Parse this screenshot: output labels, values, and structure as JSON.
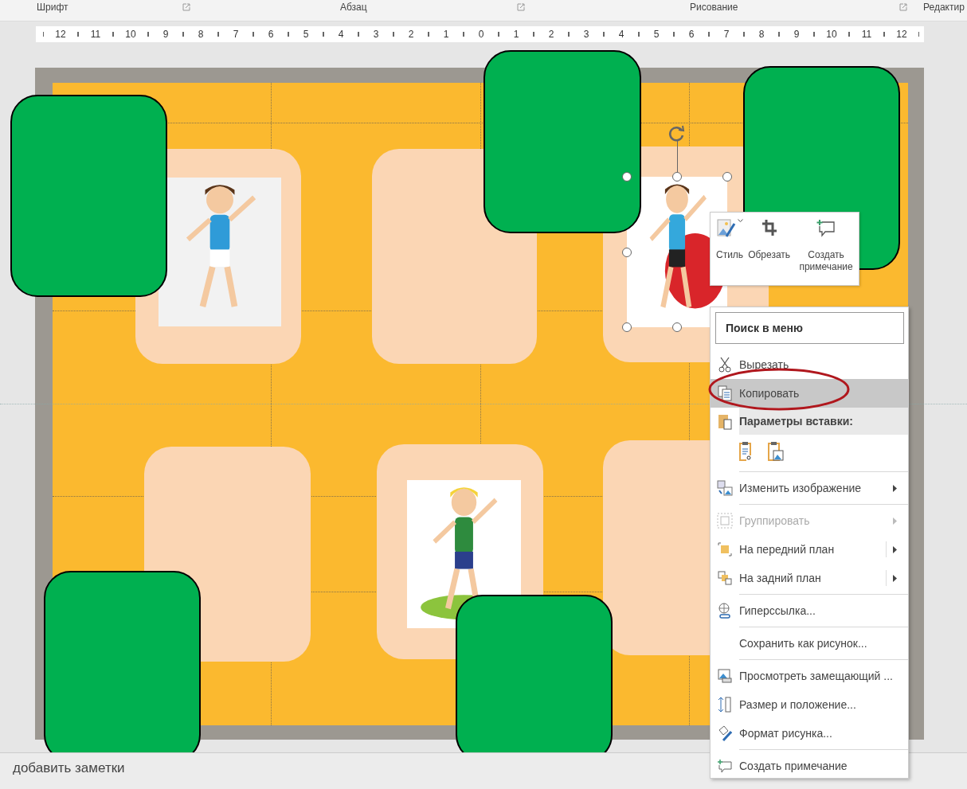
{
  "ribbon_groups": [
    {
      "label": "Шрифт",
      "launcher": true
    },
    {
      "label": "Абзац",
      "launcher": true
    },
    {
      "label": "Рисование",
      "launcher": true
    },
    {
      "label": "Редактир",
      "launcher": false
    }
  ],
  "ruler": [
    "12",
    "11",
    "10",
    "9",
    "8",
    "7",
    "6",
    "5",
    "4",
    "3",
    "2",
    "1",
    "0",
    "1",
    "2",
    "3",
    "4",
    "5",
    "6",
    "7",
    "8",
    "9",
    "10",
    "11",
    "12"
  ],
  "slide": {
    "pictures": [
      {
        "kind": "picture",
        "selected": false
      },
      {
        "kind": "picture",
        "selected": true
      },
      {
        "kind": "picture",
        "selected": false
      }
    ]
  },
  "mini_toolbar": [
    {
      "label": "Стиль",
      "dropdown": true
    },
    {
      "label": "Обрезать",
      "dropdown": false
    },
    {
      "label": "Создать примечание",
      "dropdown": false
    }
  ],
  "context_menu": {
    "search": {
      "placeholder": "Поиск в меню"
    },
    "items": [
      {
        "kind": "item",
        "label": "Вырезать",
        "selected": false,
        "disabled": false,
        "submenu": false,
        "separator_after": false
      },
      {
        "kind": "item",
        "label": "Копировать",
        "selected": true,
        "disabled": false,
        "submenu": false,
        "separator_after": false
      },
      {
        "kind": "header",
        "label": "Параметры вставки:"
      },
      {
        "kind": "paste-options",
        "separator_after": true
      },
      {
        "kind": "item",
        "label": "Изменить изображение",
        "selected": false,
        "disabled": false,
        "submenu": true,
        "separator_after": true
      },
      {
        "kind": "item",
        "label": "Группировать",
        "selected": false,
        "disabled": true,
        "submenu": true,
        "separator_after": false
      },
      {
        "kind": "item",
        "label": "На передний план",
        "selected": false,
        "disabled": false,
        "submenu": true,
        "separator_after": false
      },
      {
        "kind": "item",
        "label": "На задний план",
        "selected": false,
        "disabled": false,
        "submenu": true,
        "separator_after": true
      },
      {
        "kind": "item",
        "label": "Гиперссылка...",
        "selected": false,
        "disabled": false,
        "submenu": false,
        "separator_after": true
      },
      {
        "kind": "item",
        "label": "Сохранить как рисунок...",
        "selected": false,
        "disabled": false,
        "submenu": false,
        "separator_after": true
      },
      {
        "kind": "item",
        "label": "Просмотреть замещающий ...",
        "selected": false,
        "disabled": false,
        "submenu": false,
        "separator_after": false
      },
      {
        "kind": "item",
        "label": "Размер и положение...",
        "selected": false,
        "disabled": false,
        "submenu": false,
        "separator_after": false
      },
      {
        "kind": "item",
        "label": "Формат рисунка...",
        "selected": false,
        "disabled": false,
        "submenu": false,
        "separator_after": true
      },
      {
        "kind": "item",
        "label": "Создать примечание",
        "selected": false,
        "disabled": false,
        "submenu": false,
        "separator_after": false
      }
    ]
  },
  "notes": {
    "placeholder": "добавить заметки"
  }
}
